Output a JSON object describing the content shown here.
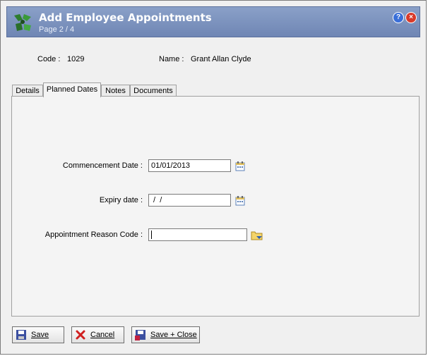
{
  "window": {
    "title": "Add Employee Appointments",
    "subtitle": "Page 2 / 4",
    "help_icon": "help-icon",
    "close_icon": "close-icon"
  },
  "info": {
    "code_label": "Code :",
    "code_value": "1029",
    "name_label": "Name :",
    "name_value": "Grant Allan Clyde"
  },
  "tabs": [
    {
      "label": "Details"
    },
    {
      "label": "Planned Dates",
      "active": true
    },
    {
      "label": "Notes"
    },
    {
      "label": "Documents"
    }
  ],
  "form": {
    "commencement_label": "Commencement Date :",
    "commencement_value": "01/01/2013",
    "expiry_label": "Expiry date :",
    "expiry_value": " /  /",
    "reason_label": "Appointment Reason Code :",
    "reason_value": ""
  },
  "buttons": {
    "save": "Save",
    "cancel": "Cancel",
    "save_close": "Save + Close"
  },
  "colors": {
    "titlebar": "#7b90bd",
    "help": "#3a6fd8",
    "close": "#d83a2a"
  }
}
